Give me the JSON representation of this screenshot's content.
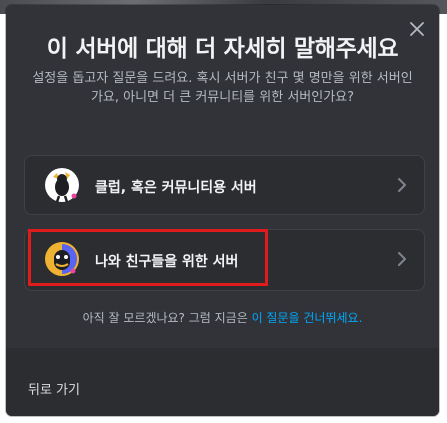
{
  "modal": {
    "title": "이 서버에 대해 더 자세히 말해주세요",
    "description": "설정을 돕고자 질문을 드려요. 혹시 서버가 친구 몇 명만을 위한 서버인가요, 아니면 더 큰 커뮤니티를 위한 서버인가요?",
    "close_icon": "close-icon",
    "options": [
      {
        "label": "클럽, 혹은 커뮤니티용 서버",
        "icon": "club-community-icon"
      },
      {
        "label": "나와 친구들을 위한 서버",
        "icon": "friends-icon"
      }
    ],
    "skip_prefix": "아직 잘 모르겠나요? 그럼 지금은 ",
    "skip_link": "이 질문을 건너뛰세요.",
    "back_label": "뒤로 가기"
  },
  "colors": {
    "background": "#313338",
    "card": "#2b2d31",
    "link": "#00a8fc",
    "highlight": "#e01b1b"
  }
}
